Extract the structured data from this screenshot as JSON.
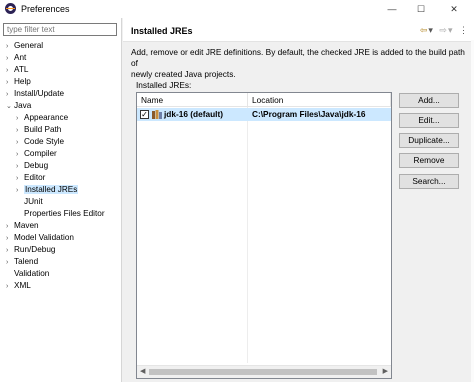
{
  "window": {
    "title": "Preferences",
    "minimize": "—",
    "maximize": "☐",
    "close": "✕"
  },
  "filter": {
    "placeholder": "type filter text"
  },
  "tree": [
    {
      "label": "General",
      "expander": "›",
      "indent": 0
    },
    {
      "label": "Ant",
      "expander": "›",
      "indent": 0
    },
    {
      "label": "ATL",
      "expander": "›",
      "indent": 0
    },
    {
      "label": "Help",
      "expander": "›",
      "indent": 0
    },
    {
      "label": "Install/Update",
      "expander": "›",
      "indent": 0
    },
    {
      "label": "Java",
      "expander": "⌄",
      "indent": 0
    },
    {
      "label": "Appearance",
      "expander": "›",
      "indent": 1
    },
    {
      "label": "Build Path",
      "expander": "›",
      "indent": 1
    },
    {
      "label": "Code Style",
      "expander": "›",
      "indent": 1
    },
    {
      "label": "Compiler",
      "expander": "›",
      "indent": 1
    },
    {
      "label": "Debug",
      "expander": "›",
      "indent": 1
    },
    {
      "label": "Editor",
      "expander": "›",
      "indent": 1
    },
    {
      "label": "Installed JREs",
      "expander": "›",
      "indent": 1,
      "selected": true
    },
    {
      "label": "JUnit",
      "expander": "",
      "indent": 1
    },
    {
      "label": "Properties Files Editor",
      "expander": "",
      "indent": 1
    },
    {
      "label": "Maven",
      "expander": "›",
      "indent": 0
    },
    {
      "label": "Model Validation",
      "expander": "›",
      "indent": 0
    },
    {
      "label": "Run/Debug",
      "expander": "›",
      "indent": 0
    },
    {
      "label": "Talend",
      "expander": "›",
      "indent": 0
    },
    {
      "label": "Validation",
      "expander": "",
      "indent": 0
    },
    {
      "label": "XML",
      "expander": "›",
      "indent": 0
    }
  ],
  "page": {
    "title": "Installed JREs",
    "description_line1": "Add, remove or edit JRE definitions. By default, the checked JRE is added to the build path of",
    "description_line2": "newly created Java projects.",
    "list_label": "Installed JREs:"
  },
  "table": {
    "columns": [
      "Name",
      "Location"
    ],
    "rows": [
      {
        "checked": true,
        "check_mark": "✓",
        "name": "jdk-16 (default)",
        "location": "C:\\Program Files\\Java\\jdk-16"
      }
    ],
    "scroll_left": "◀",
    "scroll_right": "▶"
  },
  "buttons": {
    "add": "Add...",
    "edit": "Edit...",
    "duplicate": "Duplicate...",
    "remove": "Remove",
    "search": "Search..."
  },
  "nav": {
    "back": "⇦",
    "back_menu": "▾",
    "forward": "⇨",
    "forward_menu": "▾",
    "menu": "⋮"
  },
  "icons": {
    "app": "eclipse-icon",
    "jre": "jre-library-icon"
  },
  "colors": {
    "selection": "#cce8ff",
    "accent": "#2c2255"
  }
}
